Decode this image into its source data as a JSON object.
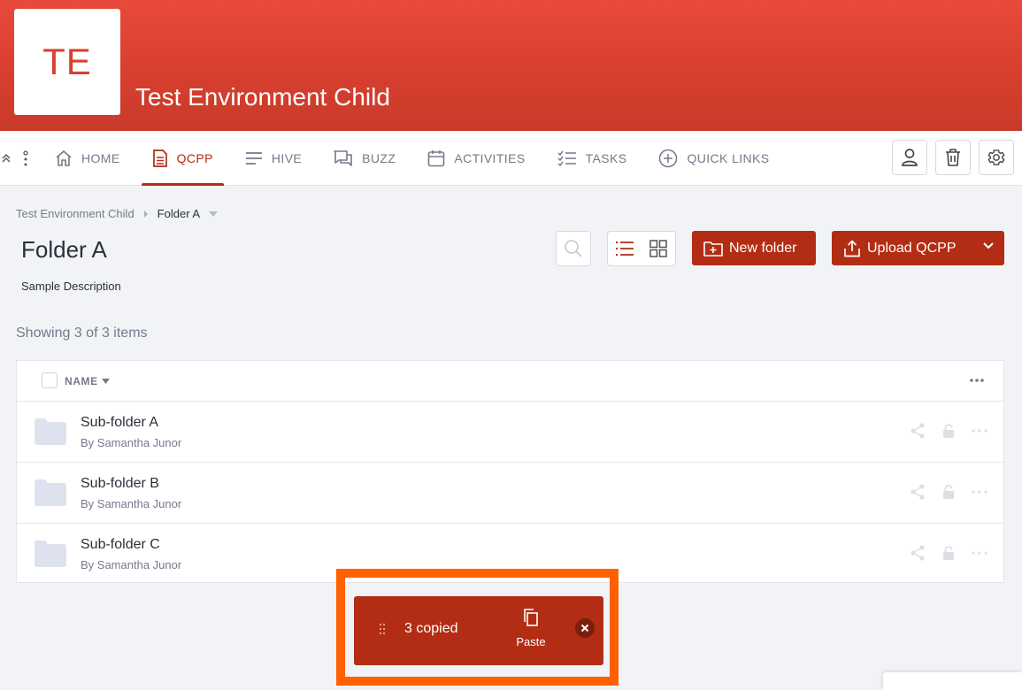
{
  "banner": {
    "logo_text": "TE",
    "title": "Test Environment Child"
  },
  "nav": {
    "items": [
      {
        "label": "HOME",
        "icon": "home-icon"
      },
      {
        "label": "QCPP",
        "icon": "document-icon",
        "active": true
      },
      {
        "label": "HIVE",
        "icon": "lines-icon"
      },
      {
        "label": "BUZZ",
        "icon": "chat-icon"
      },
      {
        "label": "ACTIVITIES",
        "icon": "calendar-icon"
      },
      {
        "label": "TASKS",
        "icon": "checklist-icon"
      },
      {
        "label": "QUICK LINKS",
        "icon": "plus-circle-icon"
      }
    ],
    "right_icons": [
      "user-icon",
      "trash-icon",
      "gear-icon"
    ]
  },
  "breadcrumb": {
    "parent": "Test Environment Child",
    "current": "Folder A"
  },
  "page": {
    "title": "Folder A",
    "description": "Sample Description"
  },
  "toolbar": {
    "new_folder_label": "New folder",
    "upload_label": "Upload QCPP"
  },
  "list": {
    "showing": "Showing 3 of 3 items",
    "column_name": "NAME",
    "rows": [
      {
        "name": "Sub-folder A",
        "by": "By Samantha Junor"
      },
      {
        "name": "Sub-folder B",
        "by": "By Samantha Junor"
      },
      {
        "name": "Sub-folder C",
        "by": "By Samantha Junor"
      }
    ]
  },
  "toast": {
    "count_text": "3 copied",
    "paste_label": "Paste"
  },
  "colors": {
    "brand": "#b22d14",
    "banner": "#d9402f",
    "highlight": "#ff6100"
  }
}
